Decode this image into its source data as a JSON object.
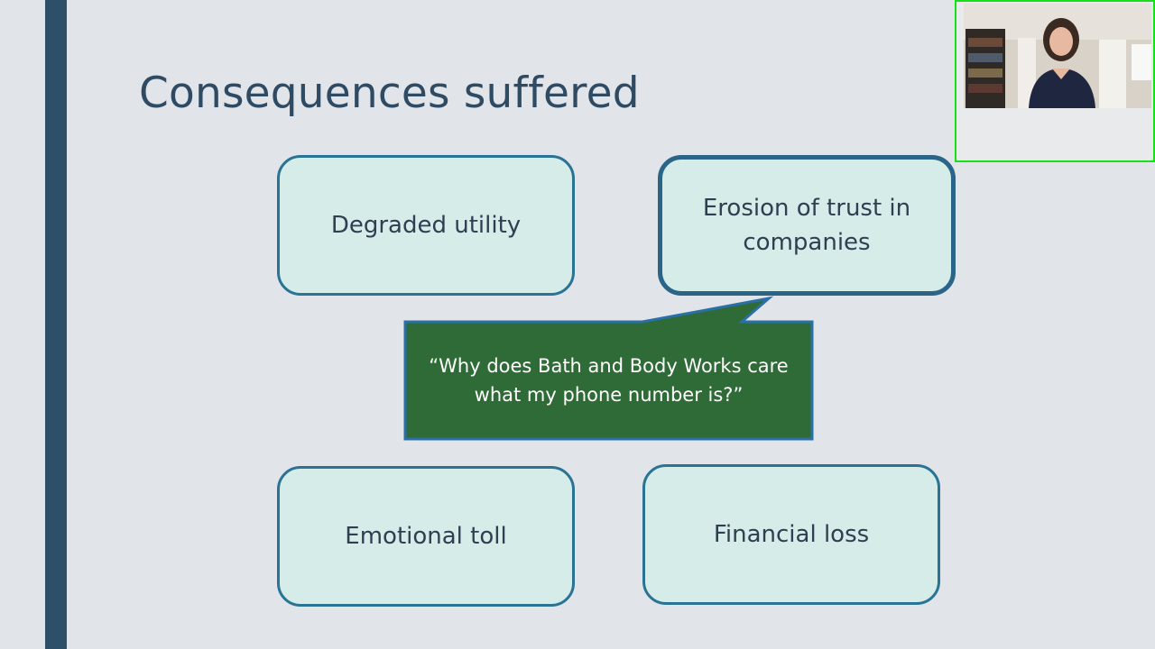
{
  "slide": {
    "title": "Consequences suffered",
    "boxes": [
      {
        "label": "Degraded utility"
      },
      {
        "label": "Erosion of trust in companies"
      },
      {
        "label": "Emotional toll"
      },
      {
        "label": "Financial loss"
      }
    ],
    "callout": {
      "text": "“Why does Bath and Body Works care what my phone number is?”",
      "fill_color": "#2e6b36",
      "border_color": "#2a6fa8"
    }
  },
  "colors": {
    "accent_bar": "#2e4f68",
    "box_fill": "#d5ece8",
    "box_border": "#2a7394",
    "video_frame_border": "#18e018"
  }
}
